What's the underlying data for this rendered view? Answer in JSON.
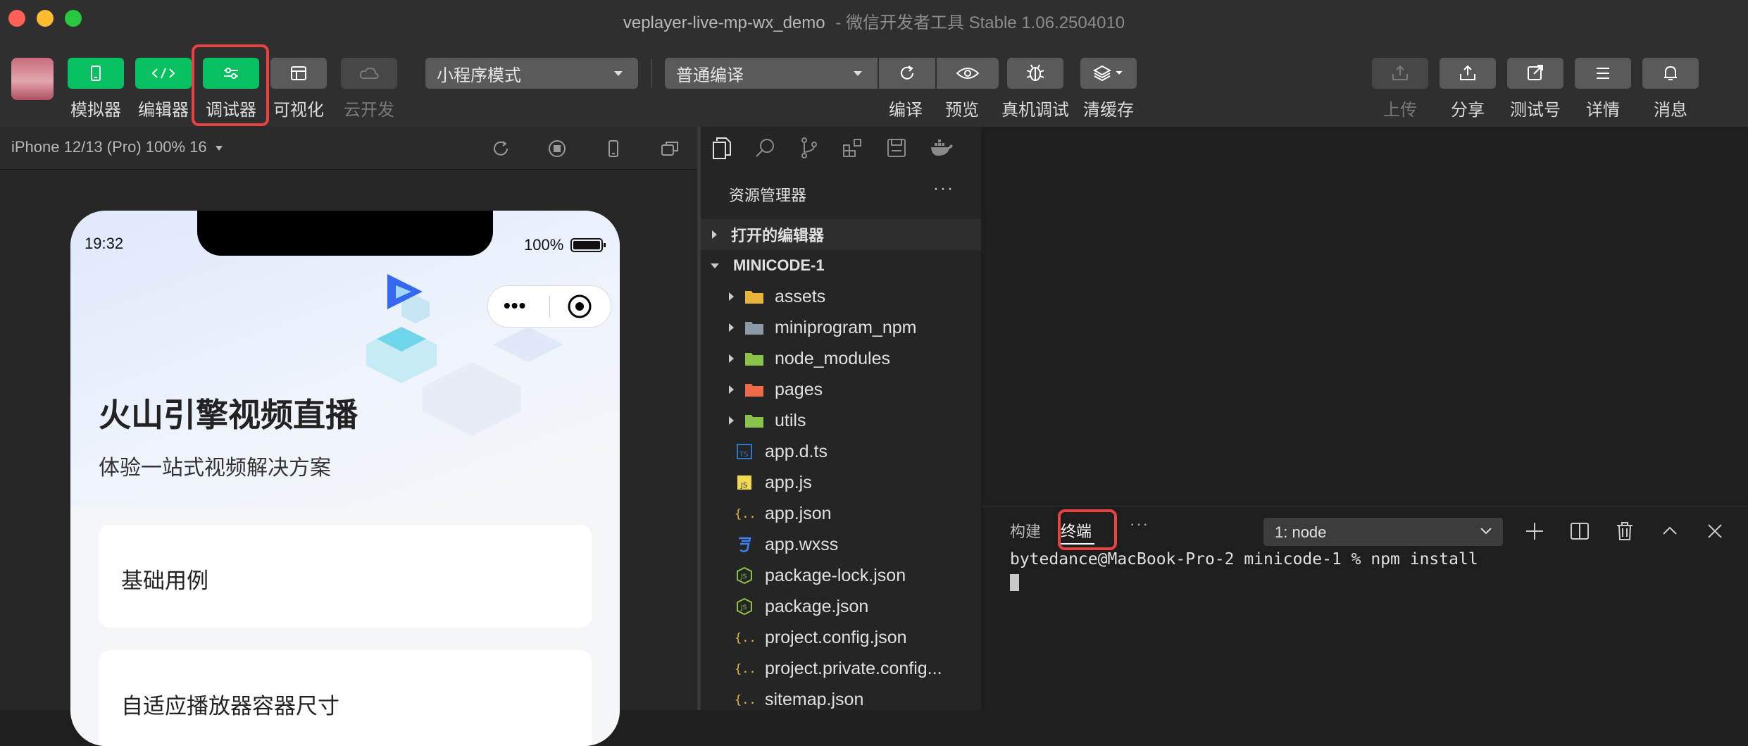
{
  "window": {
    "title": "veplayer-live-mp-wx_demo",
    "title_suffix": "- 微信开发者工具 Stable 1.06.2504010"
  },
  "toolbar": {
    "simulator": "模拟器",
    "editor": "编辑器",
    "debugger": "调试器",
    "visual": "可视化",
    "cloud": "云开发",
    "mode_select": "小程序模式",
    "compile_select": "普通编译",
    "compile": "编译",
    "preview": "预览",
    "device_debug": "真机调试",
    "clear_cache": "清缓存",
    "upload": "上传",
    "share": "分享",
    "test_account": "测试号",
    "details": "详情",
    "messages": "消息"
  },
  "simulator": {
    "device": "iPhone 12/13 (Pro) 100% 16",
    "status_time": "19:32",
    "battery": "100%",
    "heading": "火山引擎视频直播",
    "subheading": "体验一站式视频解决方案",
    "cards": [
      "基础用例",
      "自适应播放器容器尺寸"
    ]
  },
  "explorer": {
    "title": "资源管理器",
    "more": "···",
    "open_editors": "打开的编辑器",
    "project": "MINICODE-1",
    "items": [
      {
        "name": "assets",
        "type": "folder",
        "color": "#e8b43a"
      },
      {
        "name": "miniprogram_npm",
        "type": "folder",
        "color": "#8a9aa8"
      },
      {
        "name": "node_modules",
        "type": "folder",
        "color": "#8bc34a"
      },
      {
        "name": "pages",
        "type": "folder",
        "color": "#f06a4a"
      },
      {
        "name": "utils",
        "type": "folder",
        "color": "#8bc34a"
      },
      {
        "name": "app.d.ts",
        "type": "ts",
        "color": "#3178c6"
      },
      {
        "name": "app.js",
        "type": "js",
        "color": "#f0db4f"
      },
      {
        "name": "app.json",
        "type": "json",
        "color": "#e8b43a"
      },
      {
        "name": "app.wxss",
        "type": "css",
        "color": "#3b82f6"
      },
      {
        "name": "package-lock.json",
        "type": "node",
        "color": "#8bc34a"
      },
      {
        "name": "package.json",
        "type": "node",
        "color": "#8bc34a"
      },
      {
        "name": "project.config.json",
        "type": "json",
        "color": "#e8b43a"
      },
      {
        "name": "project.private.config...",
        "type": "json",
        "color": "#e8b43a"
      },
      {
        "name": "sitemap.json",
        "type": "json",
        "color": "#e8b43a"
      }
    ]
  },
  "terminal": {
    "tab_build": "构建",
    "tab_terminal": "终端",
    "more": "···",
    "select": "1: node",
    "prompt": "bytedance@MacBook-Pro-2 minicode-1 % npm install"
  }
}
